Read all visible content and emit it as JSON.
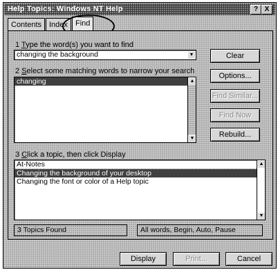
{
  "window": {
    "title": "Help Topics: Windows NT Help"
  },
  "titlebar_buttons": {
    "help": "?",
    "close": "X"
  },
  "tabs": [
    {
      "label": "Contents"
    },
    {
      "label": "Index"
    },
    {
      "label": "Find"
    }
  ],
  "step1": {
    "label_pre": "1 ",
    "label_key": "T",
    "label_post": "ype the word(s) you want to find",
    "value": "changing the background"
  },
  "step2": {
    "label_pre": "2 ",
    "label_key": "S",
    "label_post": "elect some matching words to narrow your search",
    "items": [
      "changing"
    ]
  },
  "step3": {
    "label_pre": "3 ",
    "label_key": "C",
    "label_post": "lick a topic, then click Display",
    "items": [
      "At-Notes",
      "Changing the background of your desktop",
      "Changing the font or color of a Help topic"
    ]
  },
  "side_buttons": {
    "clear": "Clear",
    "options": "Options...",
    "find_similar": "Find Similar...",
    "find_now": "Find Now",
    "rebuild": "Rebuild..."
  },
  "status": {
    "found": "3 Topics Found",
    "mode": "All words, Begin, Auto, Pause"
  },
  "bottom_buttons": {
    "display": "Display",
    "print": "Print...",
    "cancel": "Cancel"
  },
  "glyphs": {
    "dropdown": "▼",
    "up": "▲",
    "down": "▼"
  }
}
